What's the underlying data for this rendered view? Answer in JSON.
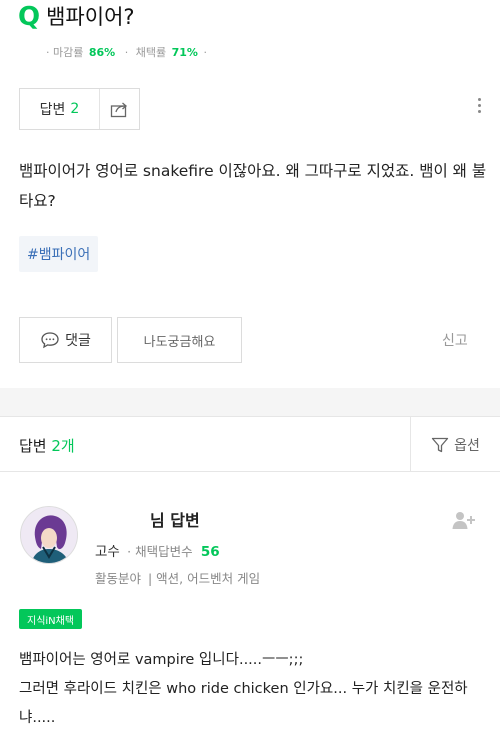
{
  "question": {
    "mark": "Q",
    "title": "뱀파이어?",
    "stats": {
      "close_label": "마감률",
      "close_pct": "86%",
      "adopt_label": "채택률",
      "adopt_pct": "71%"
    },
    "answer_label": "답변",
    "answer_count": "2",
    "body": "뱀파이어가 영어로 snakefire 이잖아요. 왜 그따구로 지었죠. 뱀이 왜 불타요?",
    "hashtag": "#뱀파이어",
    "comment_label": "댓글",
    "curious_label": "나도궁금해요",
    "report_label": "신고"
  },
  "answers_header": {
    "label": "답변",
    "count": "2개",
    "option_label": "옵션"
  },
  "answer": {
    "author": "님 답변",
    "rank": "고수",
    "adopted_label": "· 채택답변수",
    "adopted_count": "56",
    "field_label": "활동분야",
    "field_value": "| 액션, 어드벤처 게임",
    "badge": "지식iN채택",
    "body": "뱀파이어는 영어로 vampire 입니다.....ㅡㅡ;;;\n그러면 후라이드 치킨은 who ride chicken 인가요... 누가 치킨을 운전하냐....."
  },
  "colors": {
    "accent": "#03c75a",
    "hashtag": "#3a6fb7"
  },
  "icons": [
    "share-icon",
    "more-icon",
    "comment-icon",
    "filter-icon",
    "follow-icon"
  ]
}
